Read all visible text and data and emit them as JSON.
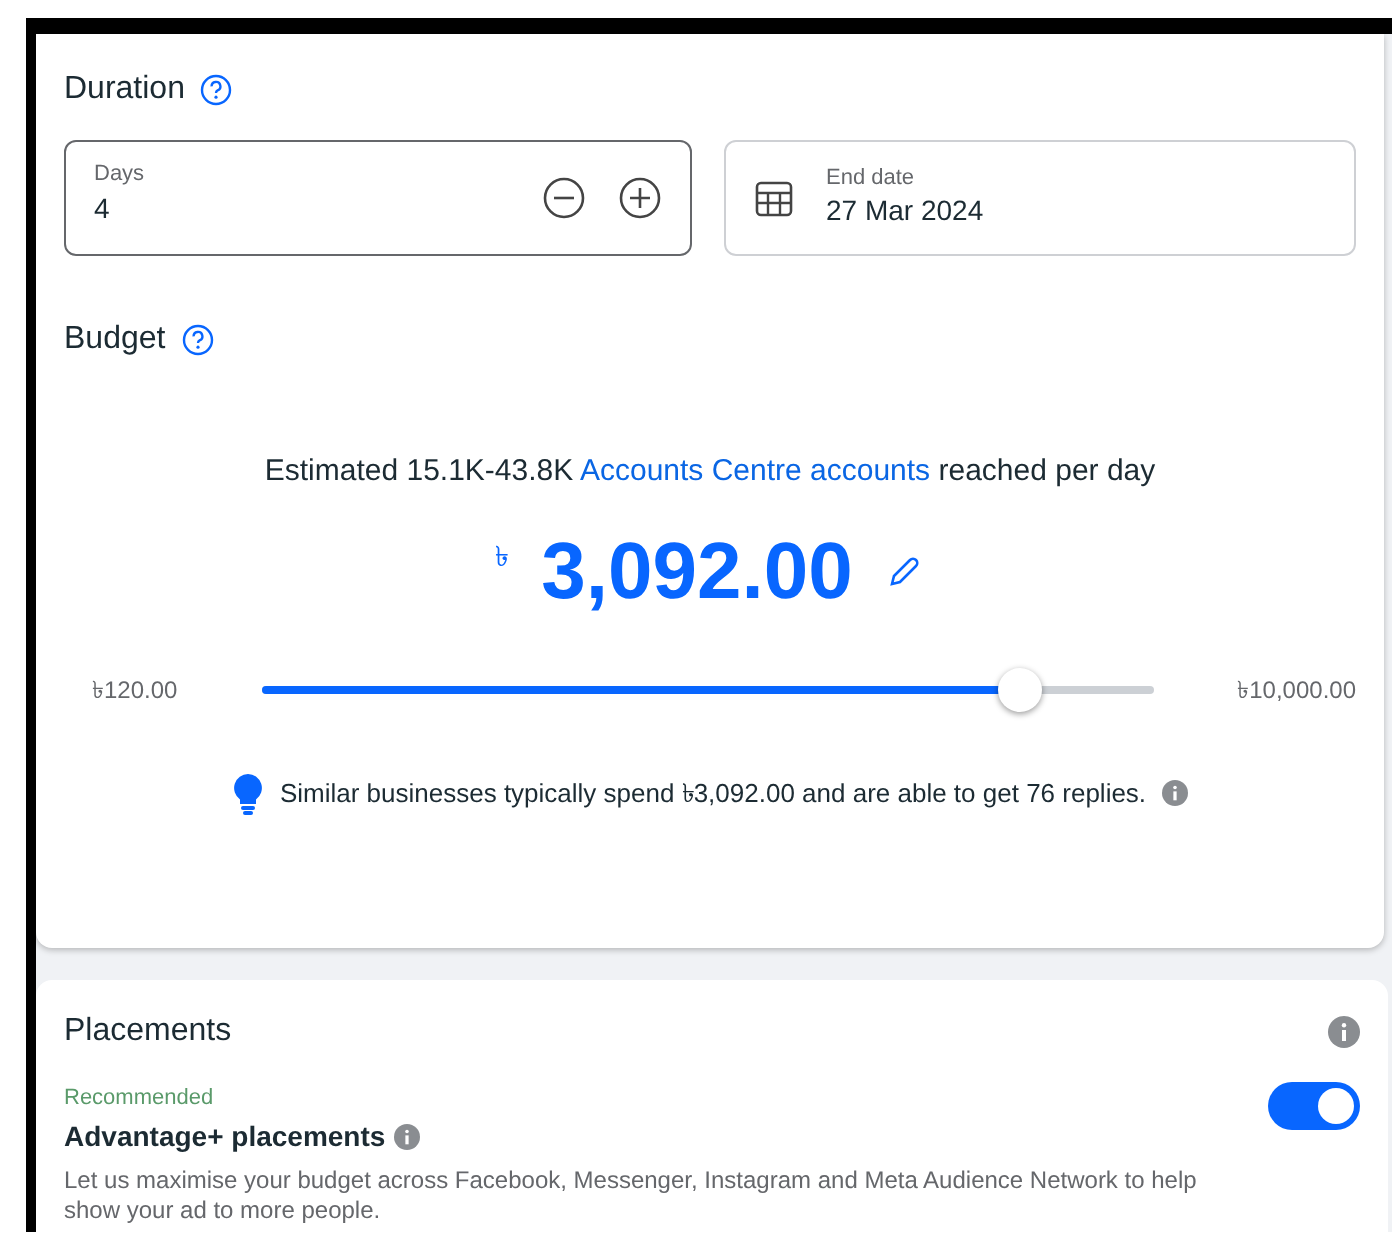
{
  "duration": {
    "title": "Duration",
    "days": {
      "label": "Days",
      "value": "4"
    },
    "end_date": {
      "label": "End date",
      "value": "27 Mar 2024"
    }
  },
  "budget": {
    "title": "Budget",
    "estimate": "Estimated 15.1K-43.8K",
    "estimate_link": "Accounts Centre accounts",
    "estimate_suffix": "reached per day",
    "currency": "৳",
    "amount": "3,092.00",
    "slider": {
      "min_label": "৳120.00",
      "max_label": "৳10,000.00",
      "level": 0.85
    },
    "tip": "Similar businesses typically spend ৳3,092.00 and are able to get 76 replies."
  },
  "placements": {
    "title": "Placements",
    "option": {
      "tag": "Recommended",
      "title": "Advantage+ placements",
      "description": "Let us maximise your budget across Facebook, Messenger, Instagram and Meta Audience Network to help show your ad to more people.",
      "on": true
    }
  }
}
